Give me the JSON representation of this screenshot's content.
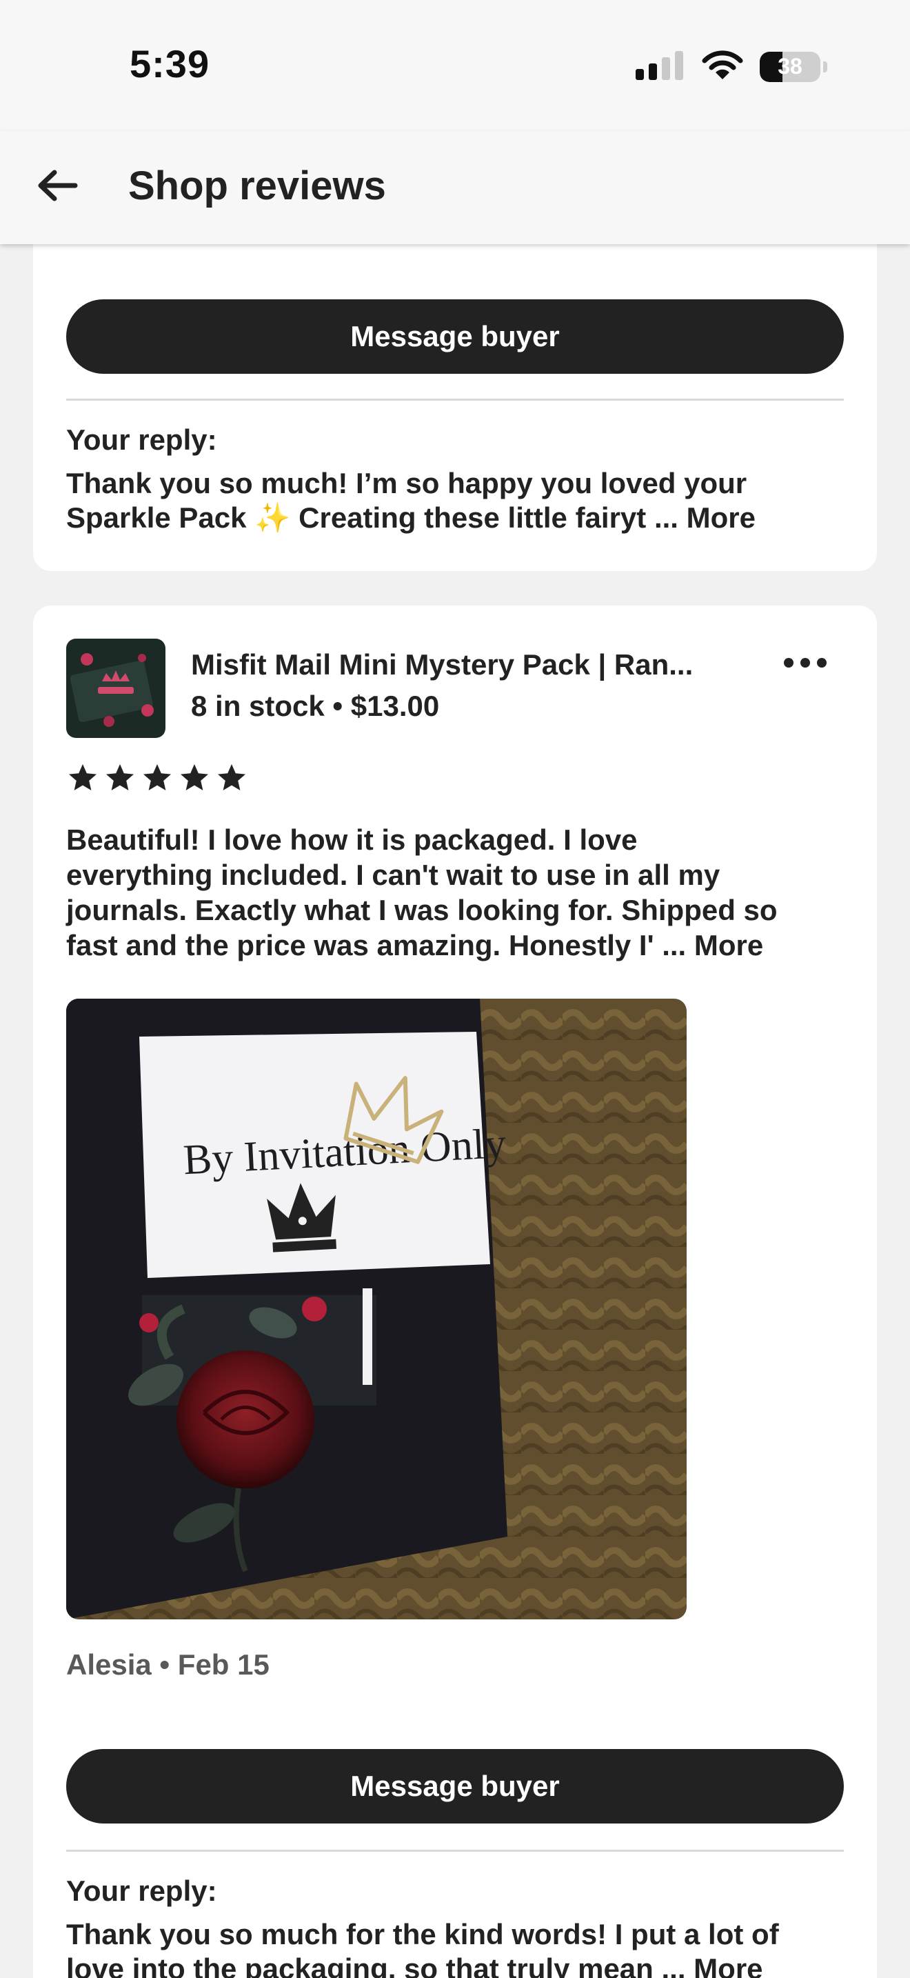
{
  "status_bar": {
    "time": "5:39",
    "battery": "38",
    "battery_level_percent": 38
  },
  "header": {
    "title": "Shop reviews",
    "back_icon": "arrow-left-icon"
  },
  "reviews": [
    {
      "message_button": "Message buyer",
      "reply_label": "Your reply:",
      "reply_line1": "Thank you so much! I’m so happy you loved your",
      "reply_line2": "Sparkle Pack ✨  Creating these little fairyt ...",
      "reply_more": "More"
    },
    {
      "listing_title": "Misfit Mail Mini Mystery Pack | Ran...",
      "listing_meta": "8 in stock • $13.00",
      "rating": 5,
      "text_lines": [
        "Beautiful!   I love how it is packaged. I love",
        "everything included. I can't wait to use in all my",
        "journals.  Exactly what I was looking for. Shipped so",
        "fast and the price was amazing. Honestly I' ..."
      ],
      "text_more": "More",
      "photo_card_text": "By Invitation Only",
      "reviewer": "Alesia • Feb 15",
      "message_button": "Message buyer",
      "reply_label": "Your reply:",
      "reply_line1": "Thank you so much for the kind words! I put a lot of",
      "reply_line2": "love into the packaging, so that truly mean ...",
      "reply_more": "More"
    }
  ],
  "colors": {
    "background": "#f1f1f1",
    "card": "#ffffff",
    "button": "#222222",
    "text": "#222222",
    "muted": "#595959"
  }
}
